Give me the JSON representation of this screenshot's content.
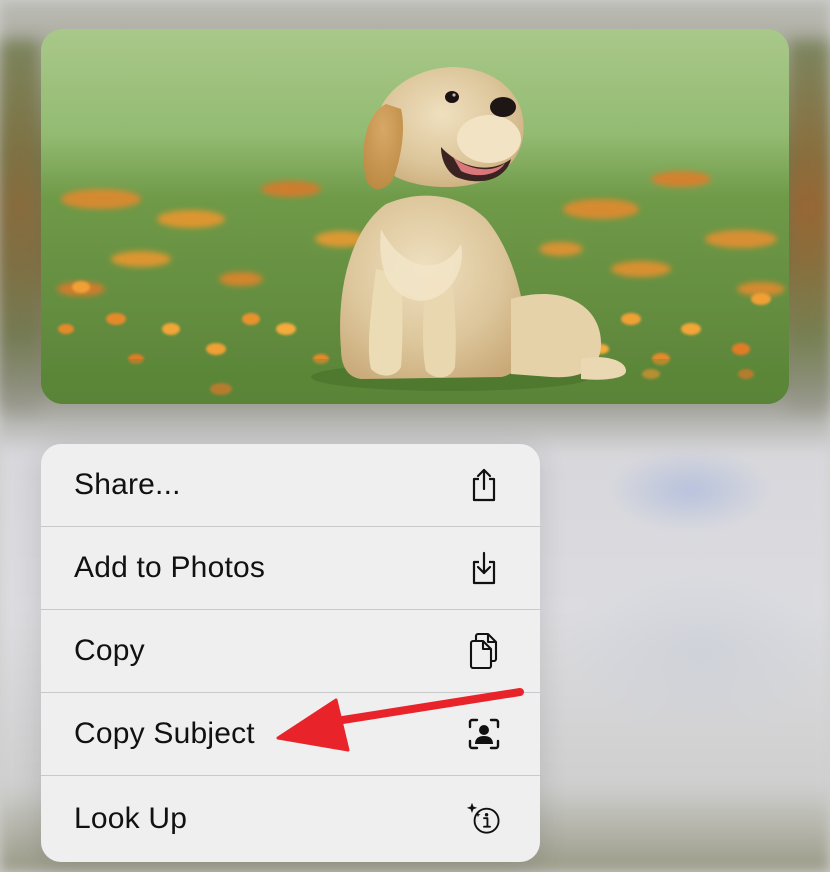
{
  "context_menu": {
    "items": [
      {
        "label": "Share...",
        "icon": "share-icon"
      },
      {
        "label": "Add to Photos",
        "icon": "add-to-photos-icon"
      },
      {
        "label": "Copy",
        "icon": "copy-icon"
      },
      {
        "label": "Copy Subject",
        "icon": "copy-subject-icon"
      },
      {
        "label": "Look Up",
        "icon": "look-up-icon"
      }
    ]
  },
  "photo": {
    "subject": "puppy-on-grass"
  },
  "annotation": {
    "type": "arrow",
    "color": "#e8242a",
    "target": "Copy Subject"
  },
  "colors": {
    "menu_background": "#efefef",
    "separator": "#c9c9cb",
    "text": "#111111",
    "arrow": "#e8242a"
  }
}
